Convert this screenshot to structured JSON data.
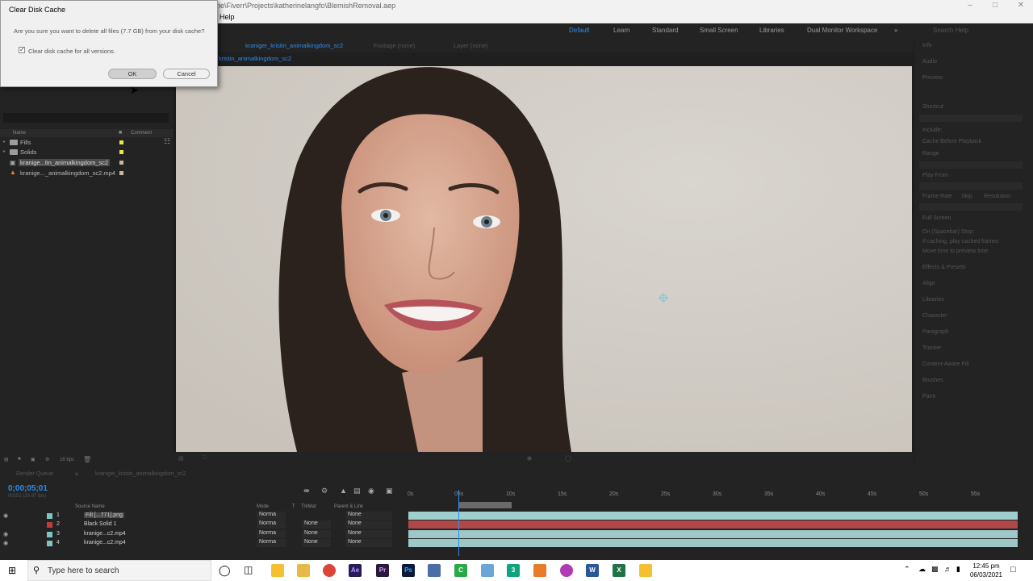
{
  "window": {
    "path": "he\\Fiverr\\Projects\\katherinelangfo\\BlemishRemoval.aep",
    "menu_help": "Help"
  },
  "workspaces": [
    "Default",
    "Learn",
    "Standard",
    "Small Screen",
    "Libraries",
    "Dual Monitor Workspace"
  ],
  "search_help": "Search Help",
  "project": {
    "col_name": "Name",
    "col_comment": "Comment",
    "items": [
      {
        "label": "Fills",
        "type": "folder",
        "color": "#e8e844"
      },
      {
        "label": "Solids",
        "type": "folder",
        "color": "#e8e844"
      },
      {
        "label": "kranige...tin_animalkingdom_sc2",
        "type": "comp",
        "color": "#c9b79c"
      },
      {
        "label": "kranige..._animalkingdom_sc2.mp4",
        "type": "footage",
        "color": "#c9b79c"
      }
    ],
    "bpc": "16 bpc"
  },
  "viewer": {
    "comp_tab": "kraniger_kristin_animalkingdom_sc2",
    "footage_tab": "Footage (none)",
    "layer_tab": "Layer (none)",
    "breadcrumb": "kristin_animalkingdom_sc2"
  },
  "right_panel": {
    "items": [
      "Info",
      "Audio",
      "Preview",
      "Shortcut",
      "Include:",
      "Cache Before Playback",
      "Range",
      "Play From",
      "Frame Rate",
      "Skip",
      "Resolution",
      "Full Screen",
      "On (Spacebar) Stop:",
      "If caching, play cached frames",
      "Move time to preview time",
      "Effects & Presets",
      "Align",
      "Libraries",
      "Character",
      "Paragraph",
      "Tracker",
      "Content-Aware Fill",
      "Brushes",
      "Paint"
    ]
  },
  "timeline": {
    "tabs": [
      "Render Queue",
      "kranigei_kristin_animalkingdom_sc2"
    ],
    "timecode": "0;00;05;01",
    "fps": "00151 (29.97 fps)",
    "columns": {
      "source": "Source Name",
      "mode": "Mode",
      "t": "T",
      "trkmat": "TrkMat",
      "parent": "Parent & Link"
    },
    "ticks": [
      "0s",
      "05s",
      "10s",
      "15s",
      "20s",
      "25s",
      "30s",
      "35s",
      "40s",
      "45s",
      "50s",
      "55s"
    ],
    "layers": [
      {
        "num": "1",
        "name": "Fill [...771].png",
        "mode": "Norma",
        "trkmat": "",
        "parent": "None",
        "label": "#7fc4c4",
        "bar": "#9ed0d0"
      },
      {
        "num": "2",
        "name": "Black Solid 1",
        "mode": "Norma",
        "trkmat": "None",
        "parent": "None",
        "label": "#c23b3b",
        "bar": "#b14848"
      },
      {
        "num": "3",
        "name": "kranige...c2.mp4",
        "mode": "Norma",
        "trkmat": "None",
        "parent": "None",
        "label": "#7fc4c4",
        "bar": "#9ec8c8"
      },
      {
        "num": "4",
        "name": "kranige...c2.mp4",
        "mode": "Norma",
        "trkmat": "None",
        "parent": "None",
        "label": "#7fc4c4",
        "bar": "#9ec8c8"
      }
    ]
  },
  "dialog": {
    "title": "Clear Disk Cache",
    "question": "Are you sure you want to delete all files (7.7 GB) from your disk cache?",
    "checkbox_label": "Clear disk cache for all versions.",
    "checkbox_checked": true,
    "ok": "OK",
    "cancel": "Cancel"
  },
  "taskbar": {
    "search_placeholder": "Type here to search",
    "time": "12:45 pm",
    "date": "06/03/2021"
  }
}
